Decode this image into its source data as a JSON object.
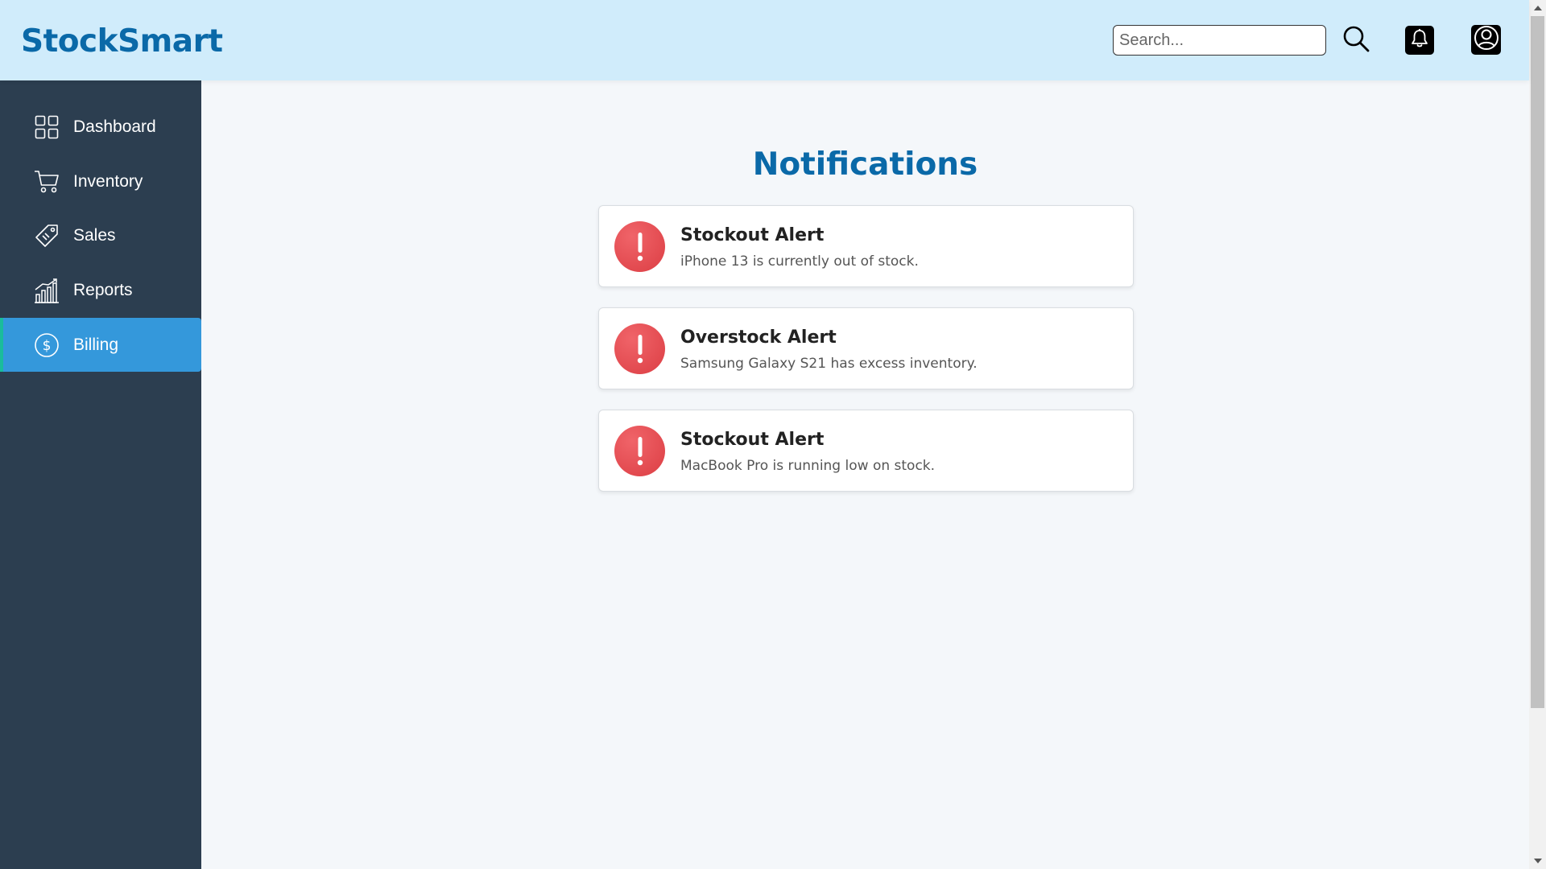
{
  "app": {
    "brand": "StockSmart"
  },
  "header": {
    "search_placeholder": "Search...",
    "search_value": "",
    "icons": [
      "search-icon",
      "bell-icon",
      "user-icon"
    ]
  },
  "sidebar": {
    "items": [
      {
        "label": "Dashboard",
        "icon": "grid-icon",
        "active": false
      },
      {
        "label": "Inventory",
        "icon": "cart-icon",
        "active": false
      },
      {
        "label": "Sales",
        "icon": "tag-icon",
        "active": false
      },
      {
        "label": "Reports",
        "icon": "bar-chart-icon",
        "active": false
      },
      {
        "label": "Billing",
        "icon": "dollar-icon",
        "active": true
      }
    ]
  },
  "main": {
    "title": "Notifications",
    "notifications": [
      {
        "title": "Stockout Alert",
        "message": "iPhone 13 is currently out of stock.",
        "icon": "alert-icon"
      },
      {
        "title": "Overstock Alert",
        "message": "Samsung Galaxy S21 has excess inventory.",
        "icon": "alert-icon"
      },
      {
        "title": "Stockout Alert",
        "message": "MacBook Pro is running low on stock.",
        "icon": "alert-icon"
      }
    ]
  },
  "colors": {
    "header_bg": "#d0ecfb",
    "brand": "#0a69a8",
    "sidebar_bg": "#2c3e50",
    "sidebar_active": "#3498db",
    "sidebar_active_border": "#1abc9c",
    "alert_red": "#dc3e44",
    "page_bg": "#f4f7fa"
  }
}
